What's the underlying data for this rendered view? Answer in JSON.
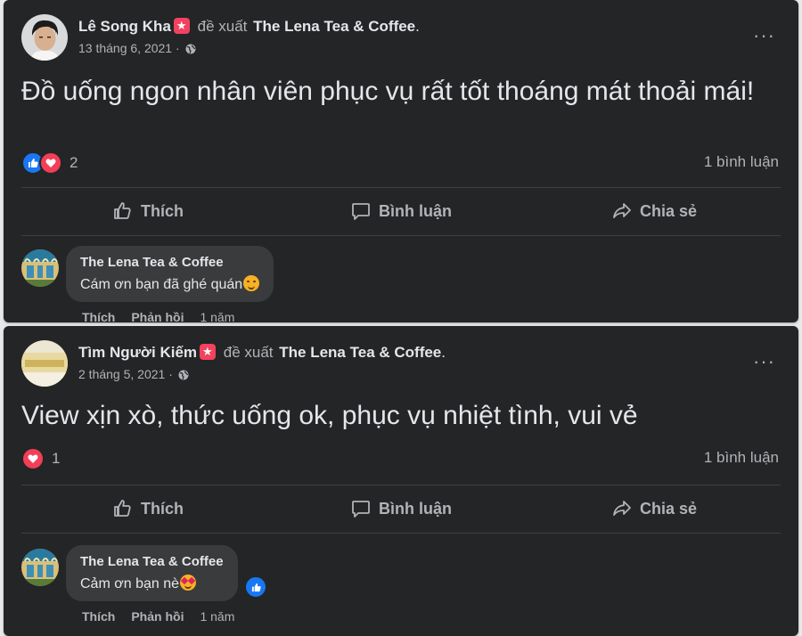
{
  "posts": [
    {
      "author": "Lê Song Kha",
      "verb": "đề xuất",
      "page": "The Lena Tea & Coffee",
      "date": "13 tháng 6, 2021 ·",
      "text": "Đồ uống ngon nhân viên phục vụ rất tốt thoáng mát thoải mái!",
      "reaction_count": "2",
      "reactions": [
        "like-icon",
        "love-icon"
      ],
      "comment_count": "1 bình luận",
      "more_label": "···",
      "actions": {
        "like": "Thích",
        "comment": "Bình luận",
        "share": "Chia sẻ"
      },
      "reply": {
        "author": "The Lena Tea & Coffee",
        "text": "Cám ơn bạn đã ghé quán",
        "emoji": "smile-emoji",
        "like": "Thích",
        "respond": "Phản hồi",
        "time": "1 năm"
      }
    },
    {
      "author": "Tìm Người Kiếm",
      "verb": "đề xuất",
      "page": "The Lena Tea & Coffee",
      "date": "2 tháng 5, 2021 ·",
      "text": "View xịn xò, thức uống ok, phục vụ nhiệt tình, vui vẻ",
      "reaction_count": "1",
      "reactions": [
        "love-icon"
      ],
      "comment_count": "1 bình luận",
      "more_label": "···",
      "actions": {
        "like": "Thích",
        "comment": "Bình luận",
        "share": "Chia sẻ"
      },
      "reply": {
        "author": "The Lena Tea & Coffee",
        "text": "Cảm ơn bạn nè",
        "emoji": "love-face-emoji",
        "reaction": "like-icon",
        "like": "Thích",
        "respond": "Phản hồi",
        "time": "1 năm"
      }
    }
  ],
  "colors": {
    "card": "#242526",
    "bubble": "#3a3b3c",
    "text": "#e4e6eb",
    "muted": "#b0b3b8",
    "like_blue": "#1877f2",
    "love_red": "#f33e58",
    "recommend_red": "#f3425f"
  }
}
